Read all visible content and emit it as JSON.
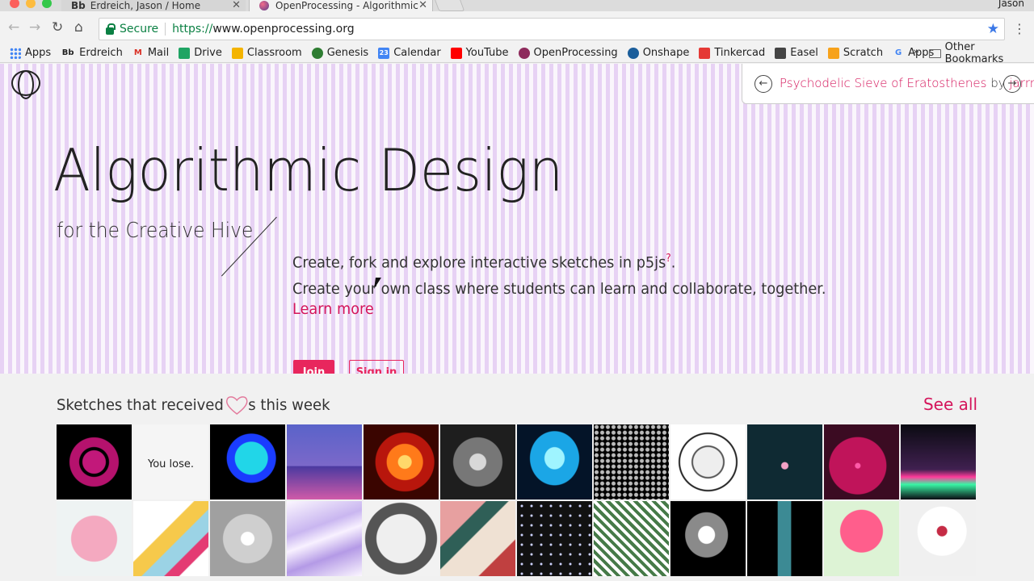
{
  "browser": {
    "tabs": [
      {
        "icon": "Bb",
        "label": "Erdreich, Jason / Home"
      },
      {
        "label": "OpenProcessing - Algorithmic"
      }
    ],
    "profile_name": "Jason",
    "secure_label": "Secure",
    "url_scheme": "https://",
    "url_host": "www.openprocessing.org",
    "bookmarks": [
      {
        "label": "Apps",
        "icon": "apps-grid-icon",
        "color": "#4285f4"
      },
      {
        "label": "Erdreich",
        "icon": "Bb",
        "color": "#222222"
      },
      {
        "label": "Mail",
        "icon": "gmail-icon",
        "color": "#d93025"
      },
      {
        "label": "Drive",
        "icon": "drive-icon",
        "color": "#1fa463"
      },
      {
        "label": "Classroom",
        "icon": "classroom-icon",
        "color": "#f4b400"
      },
      {
        "label": "Genesis",
        "icon": "genesis-icon",
        "color": "#2e7d32"
      },
      {
        "label": "Calendar",
        "icon": "calendar-icon",
        "color": "#4285f4"
      },
      {
        "label": "YouTube",
        "icon": "youtube-icon",
        "color": "#ff0000"
      },
      {
        "label": "OpenProcessing",
        "icon": "openprocessing-icon",
        "color": "#8e2b5c"
      },
      {
        "label": "Onshape",
        "icon": "onshape-icon",
        "color": "#1b5e9b"
      },
      {
        "label": "Tinkercad",
        "icon": "tinkercad-icon",
        "color": "#e53935"
      },
      {
        "label": "Easel",
        "icon": "easel-icon",
        "color": "#444444"
      },
      {
        "label": "Scratch",
        "icon": "scratch-icon",
        "color": "#f7a21b"
      },
      {
        "label": "Apps",
        "icon": "google-icon",
        "color": "#4285f4"
      }
    ],
    "more_bookmarks": "»",
    "other_bookmarks": "Other Bookmarks"
  },
  "hero": {
    "featured_title": "Psychodelic Sieve of Eratosthenes",
    "featured_by": "by",
    "featured_author": "jarrn",
    "title": "Algorithmic Design",
    "subtitle": "for the Creative Hive",
    "desc1": "Create, fork and explore interactive sketches in p5js",
    "desc1_sup": "?",
    "desc1_end": ".",
    "desc2": "Create your own class where students can learn and collaborate, together.",
    "learn_more": "Learn more",
    "join": "Join",
    "sign_in": "Sign in"
  },
  "sketches": {
    "heading_before": "Sketches that received",
    "heading_after": "s this week",
    "see_all": "See all",
    "thumb_label": "You lose.",
    "accent_color": "#d4145a"
  }
}
